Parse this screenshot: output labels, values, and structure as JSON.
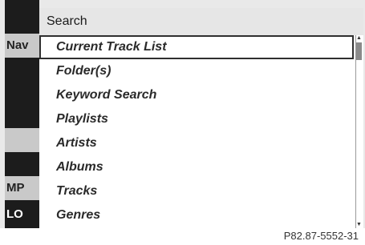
{
  "menu": {
    "title": "Search",
    "items": [
      {
        "label": "Current Track List",
        "selected": true
      },
      {
        "label": "Folder(s)"
      },
      {
        "label": "Keyword Search"
      },
      {
        "label": "Playlists"
      },
      {
        "label": "Artists"
      },
      {
        "label": "Albums"
      },
      {
        "label": "Tracks"
      },
      {
        "label": "Genres"
      }
    ]
  },
  "background_strip": {
    "nav_label": "Nav",
    "mp_label": "MP",
    "lo_label": "LO"
  },
  "scrollbar": {
    "up_icon": "arrow-up-icon",
    "down_icon": "arrow-down-icon"
  },
  "footer": {
    "reference": "P82.87-5552-31"
  },
  "colors": {
    "menu_bg": "#ffffff",
    "title_bg": "#e6e6e6",
    "dark": "#1c1c1c",
    "selection_border": "#2f2f2f"
  }
}
